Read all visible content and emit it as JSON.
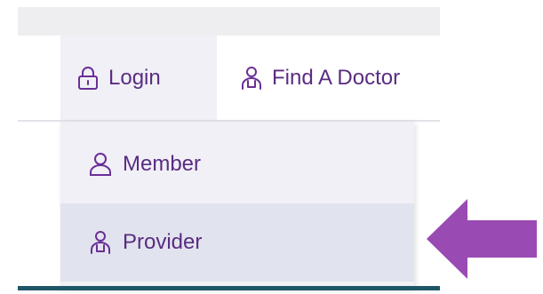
{
  "nav": {
    "login_label": "Login",
    "find_doctor_label": "Find A Doctor"
  },
  "dropdown": {
    "items": [
      {
        "label": "Member",
        "icon": "person-icon"
      },
      {
        "label": "Provider",
        "icon": "doctor-icon"
      }
    ],
    "highlighted": "Provider"
  },
  "colors": {
    "accent": "#5a2c82",
    "arrow": "#9a4ab3",
    "dropdown_bg": "#f0f0f6",
    "hover_bg": "#e1e4ee",
    "bottom_bar": "#1e5668"
  },
  "annotation": {
    "icon": "arrow-left-icon",
    "points_to": "Provider"
  }
}
